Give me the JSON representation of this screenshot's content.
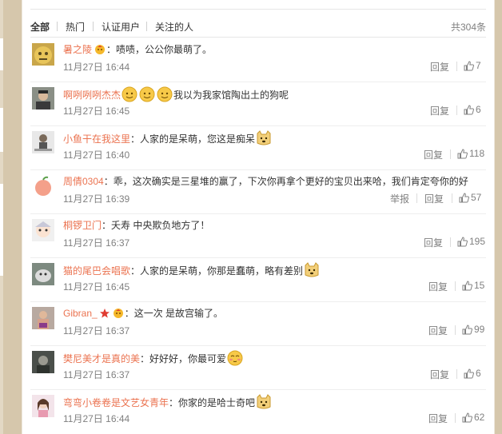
{
  "tabs": [
    "全部",
    "热门",
    "认证用户",
    "关注的人"
  ],
  "total": "共304条",
  "reply_label": "回复",
  "report_label": "举报",
  "colors": {
    "username": "#eb7350",
    "accent_gold": "#f5b82b"
  },
  "comments": [
    {
      "user": "暑之陵",
      "text": "：啧啧，公公你最萌了。",
      "time": "11月27日 16:44",
      "likes": "7",
      "avatar": "gold-head-avatar"
    },
    {
      "user": "啊咧咧咧杰杰",
      "text": "我以为我家馆陶出土的狗呢",
      "time": "11月27日 16:45",
      "likes": "6",
      "avatar": "portrait-avatar"
    },
    {
      "user": "小鱼干在我这里",
      "text": "：人家的是呆萌，您这是痴呆",
      "time": "11月27日 16:40",
      "likes": "118",
      "avatar": "figure-avatar"
    },
    {
      "user": "周倩0304",
      "text": "：乖，这次确实是三星堆的赢了，下次你再拿个更好的宝贝出来哈，我们肯定夸你的好",
      "time": "11月27日 16:39",
      "likes": "57",
      "avatar": "peach-avatar"
    },
    {
      "user": "桐锣卫门",
      "text": "：夭寿 中央欺负地方了！",
      "time": "11月27日 16:37",
      "likes": "195",
      "avatar": "cartoon-avatar"
    },
    {
      "user": "猫的尾巴会唱歌",
      "text": "：人家的是呆萌，你那是蠢萌，略有差别",
      "time": "11月27日 16:45",
      "likes": "15",
      "avatar": "cat-avatar"
    },
    {
      "user": "Gibran_",
      "text": "：这一次 是故宫输了。",
      "time": "11月27日 16:37",
      "likes": "99",
      "avatar": "person-avatar"
    },
    {
      "user": "樊尼美才是真的美",
      "text": "：好好好，你最可爱",
      "time": "11月27日 16:37",
      "likes": "6",
      "avatar": "dark-avatar"
    },
    {
      "user": "弯弯小卷卷是文艺女青年",
      "text": "：你家的是哈士奇吧",
      "time": "11月27日 16:44",
      "likes": "62",
      "avatar": "girl-avatar"
    }
  ]
}
